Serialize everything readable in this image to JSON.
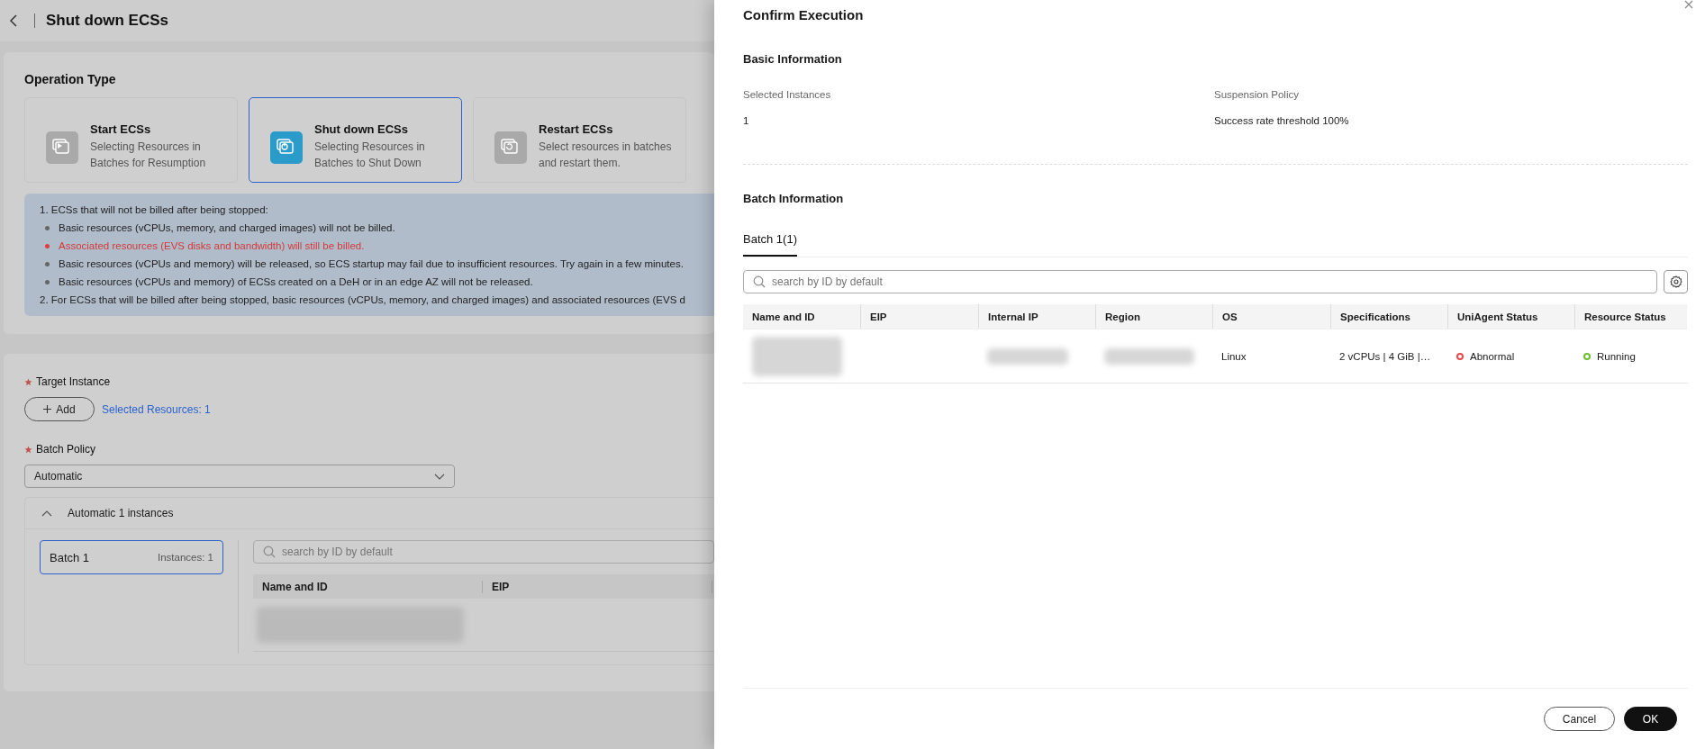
{
  "page": {
    "title": "Shut down ECSs"
  },
  "operation_type": {
    "label": "Operation Type",
    "options": [
      {
        "title": "Start ECSs",
        "description": "Selecting Resources in Batches for Resumption",
        "selected": false,
        "kind": "start"
      },
      {
        "title": "Shut down ECSs",
        "description": "Selecting Resources in Batches to Shut Down",
        "selected": true,
        "kind": "stop"
      },
      {
        "title": "Restart ECSs",
        "description": "Select resources in batches and restart them.",
        "selected": false,
        "kind": "restart"
      }
    ]
  },
  "notice": {
    "items": [
      {
        "kind": "heading",
        "text": "1. ECSs that will not be billed after being stopped:"
      },
      {
        "kind": "bullet",
        "text": "Basic resources (vCPUs, memory, and charged images) will not be billed."
      },
      {
        "kind": "warning",
        "text": "Associated resources (EVS disks and bandwidth) will still be billed."
      },
      {
        "kind": "bullet",
        "text": "Basic resources (vCPUs and memory) will be released, so ECS startup may fail due to insufficient resources. Try again in a few minutes."
      },
      {
        "kind": "bullet",
        "text": "Basic resources (vCPUs and memory) of ECSs created on a DeH or in an edge AZ will not be released."
      },
      {
        "kind": "heading",
        "text": "2. For ECSs that will be billed after being stopped, basic resources (vCPUs, memory, and charged images) and associated resources (EVS d"
      }
    ]
  },
  "target_instance": {
    "label": "Target Instance",
    "required": true,
    "add_button": "Add",
    "selected_resources": "Selected Resources: 1"
  },
  "batch_policy": {
    "label": "Batch Policy",
    "required": true,
    "value": "Automatic"
  },
  "batch_group": {
    "title": "Automatic 1 instances",
    "expanded": true,
    "batches": [
      {
        "name": "Batch 1",
        "count": "Instances: 1",
        "selected": true
      }
    ],
    "search": {
      "placeholder": "search by ID by default"
    },
    "columns": [
      "Name and ID",
      "EIP"
    ]
  },
  "drawer": {
    "title": "Confirm Execution",
    "basic_info": {
      "heading": "Basic Information",
      "fields": [
        {
          "label": "Selected Instances",
          "value": "1"
        },
        {
          "label": "Suspension Policy",
          "value": "Success rate threshold 100%"
        }
      ]
    },
    "batch_info": {
      "heading": "Batch Information",
      "tabs": [
        {
          "label": "Batch 1(1)",
          "selected": true
        }
      ],
      "search": {
        "placeholder": "search by ID by default"
      },
      "columns": [
        "Name and ID",
        "EIP",
        "Internal IP",
        "Region",
        "OS",
        "Specifications",
        "UniAgent Status",
        "Resource Status"
      ],
      "rows": [
        {
          "os": "Linux",
          "specifications": "2 vCPUs | 4 GiB |…",
          "uniagent_status": {
            "text": "Abnormal",
            "color": "#e8474c"
          },
          "resource_status": {
            "text": "Running",
            "color": "#6cbf2e"
          }
        }
      ]
    },
    "buttons": [
      {
        "label": "Cancel",
        "kind": "secondary"
      },
      {
        "label": "OK",
        "kind": "primary"
      }
    ]
  }
}
